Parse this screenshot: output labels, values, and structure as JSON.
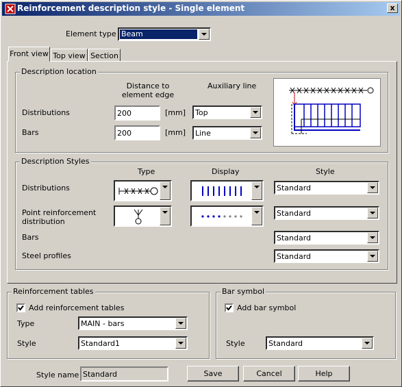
{
  "window": {
    "title": "Reinforcement description style - Single element",
    "close_glyph": "x"
  },
  "element_type": {
    "label": "Element type :",
    "value": "Beam"
  },
  "tabs": [
    {
      "label": "Front view"
    },
    {
      "label": "Top view"
    },
    {
      "label": "Section"
    }
  ],
  "description_location": {
    "title": "Description location",
    "col_distance": "Distance to element edge",
    "col_aux": "Auxiliary line",
    "distributions": {
      "label": "Distributions",
      "distance": "200",
      "unit": "[mm]",
      "aux": "Top"
    },
    "bars": {
      "label": "Bars",
      "distance": "200",
      "unit": "[mm]",
      "aux": "Line"
    }
  },
  "description_styles": {
    "title": "Description Styles",
    "col_type": "Type",
    "col_display": "Display",
    "col_style": "Style",
    "rows": [
      {
        "label": "Distributions",
        "style": "Standard"
      },
      {
        "label": "Point reinforcement distribution",
        "style": "Standard"
      },
      {
        "label": "Bars",
        "style": "Standard"
      },
      {
        "label": "Steel profiles",
        "style": "Standard"
      }
    ]
  },
  "reinforcement_tables": {
    "title": "Reinforcement tables",
    "add_label": "Add reinforcement tables",
    "add_checked": true,
    "type_label": "Type",
    "type_value": "MAIN - bars",
    "style_label": "Style",
    "style_value": "Standard1"
  },
  "bar_symbol": {
    "title": "Bar symbol",
    "add_label": "Add bar symbol",
    "add_checked": true,
    "style_label": "Style",
    "style_value": "Standard"
  },
  "footer": {
    "style_name_label": "Style name :",
    "style_name_value": "Standard",
    "save": "Save",
    "cancel": "Cancel",
    "help": "Help"
  },
  "colors": {
    "titlebar_start": "#0a246a",
    "titlebar_end": "#a6caf0",
    "accent_blue": "#0000c0",
    "marker_red": "#c00000"
  }
}
